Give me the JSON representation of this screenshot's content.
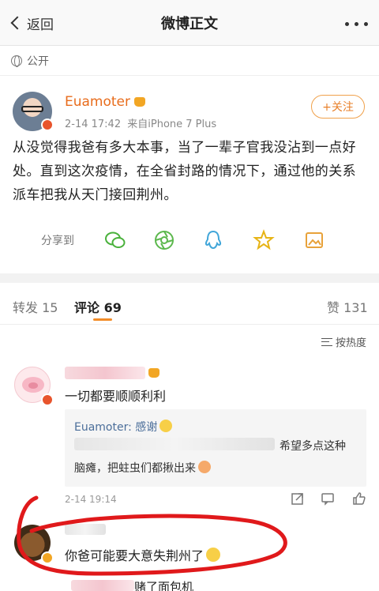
{
  "nav": {
    "back_label": "返回",
    "title": "微博正文"
  },
  "visibility": {
    "label": "公开"
  },
  "post": {
    "author": "Euamoter",
    "time": "2-14 17:42",
    "source": "来自iPhone 7 Plus",
    "follow_label": "+关注",
    "text": "从没觉得我爸有多大本事，当了一辈子官我没沾到一点好处。直到这次疫情，在全省封路的情况下，通过他的关系派车把我从天门接回荆州。"
  },
  "share": {
    "label": "分享到",
    "icons": [
      "wechat-icon",
      "moments-icon",
      "qq-icon",
      "qzone-icon",
      "album-icon"
    ]
  },
  "tabs": {
    "repost": "转发 15",
    "comments": "评论 69",
    "likes": "赞 131"
  },
  "sort": {
    "label": "按热度"
  },
  "comments": [
    {
      "text": "一切都要顺顺利利",
      "reply_author": "Euamoter: 感谢",
      "reply_line1_tail": "希望多点这种",
      "reply_line2": "脑瘫，把蛀虫们都揪出来",
      "time": "2-14 19:14"
    },
    {
      "text": "你爸可能要大意失荆州了",
      "partial_text": "赌了面包机"
    }
  ],
  "colors": {
    "accent": "#f28c28",
    "author": "#e86c1c",
    "link": "#4b6e9a",
    "annotation": "#e0191b"
  }
}
